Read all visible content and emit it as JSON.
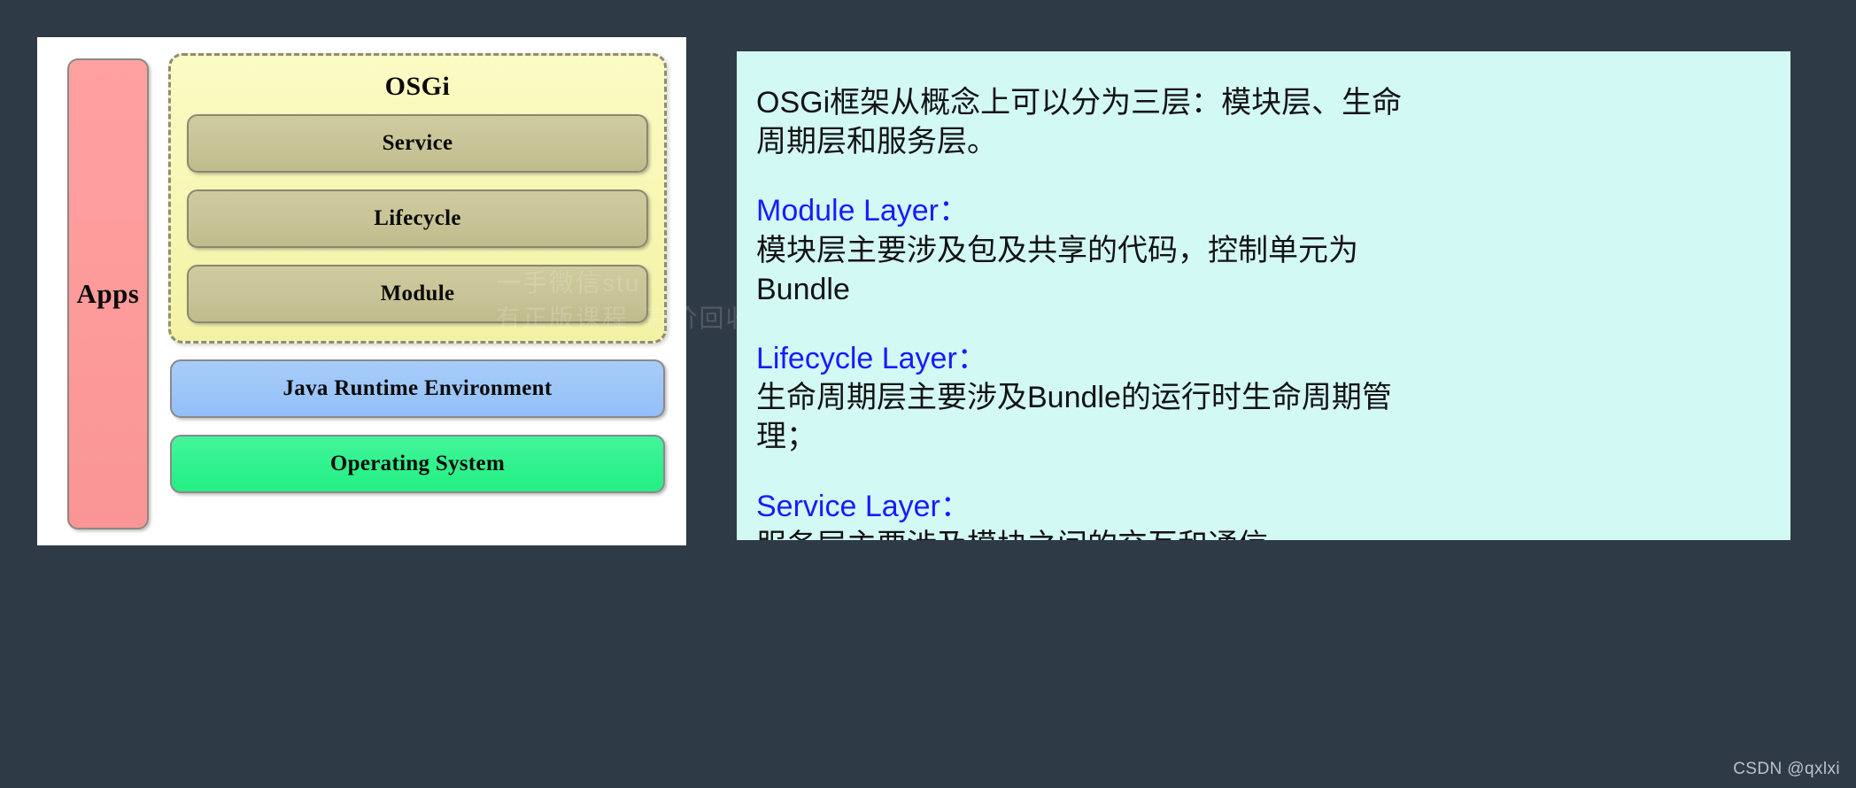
{
  "background_color": "#2f3a47",
  "diagram": {
    "panel_background": "#ffffff",
    "apps": {
      "label": "Apps",
      "color": "#fd9a9a"
    },
    "osgi": {
      "title": "OSGi",
      "color": "#f7f6b2",
      "layers": [
        {
          "label": "Service",
          "color": "#c8c497"
        },
        {
          "label": "Lifecycle",
          "color": "#c8c497"
        },
        {
          "label": "Module",
          "color": "#c8c497"
        }
      ]
    },
    "platform": [
      {
        "label": "Java Runtime Environment",
        "color": "#9cc6f8"
      },
      {
        "label": "Operating System",
        "color": "#2ff28c"
      }
    ]
  },
  "notes": {
    "panel_background": "#d3f9f5",
    "heading_color": "#1a1aff",
    "body_color": "#131313",
    "intro": "OSGi框架从概念上可以分为三层：模块层、生命\n周期层和服务层。",
    "sections": [
      {
        "heading": "Module Layer：",
        "body": "模块层主要涉及包及共享的代码，控制单元为\nBundle"
      },
      {
        "heading": "Lifecycle Layer：",
        "body": "生命周期层主要涉及Bundle的运行时生命周期管\n理；"
      },
      {
        "heading": "Service Layer：",
        "body": "服务层主要涉及模块之间的交互和通信。"
      }
    ]
  },
  "watermarks": {
    "center": "一手微信stu\n有正版课程  高价回收",
    "corner": "CSDN @qxlxi"
  }
}
